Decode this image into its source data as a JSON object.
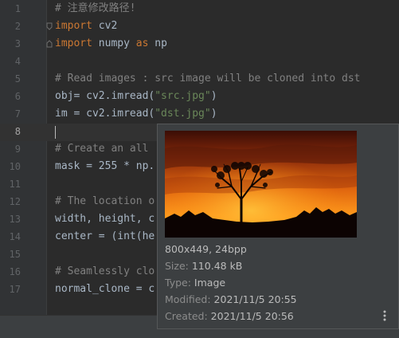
{
  "editor": {
    "active_line": "8",
    "lines": [
      {
        "n": "1",
        "code": [
          {
            "t": "# 注意修改路径!",
            "c": "cm"
          }
        ]
      },
      {
        "n": "2",
        "code": [
          {
            "t": "import",
            "c": "kw"
          },
          {
            "t": " cv2",
            "c": ""
          }
        ]
      },
      {
        "n": "3",
        "code": [
          {
            "t": "import",
            "c": "kw"
          },
          {
            "t": " numpy ",
            "c": ""
          },
          {
            "t": "as",
            "c": "kw"
          },
          {
            "t": " np",
            "c": ""
          }
        ]
      },
      {
        "n": "4",
        "code": []
      },
      {
        "n": "5",
        "code": [
          {
            "t": "# Read images : src image will be cloned into dst",
            "c": "cm"
          }
        ]
      },
      {
        "n": "6",
        "code": [
          {
            "t": "obj= cv2.imread(",
            "c": ""
          },
          {
            "t": "\"src.jpg\"",
            "c": "st"
          },
          {
            "t": ")",
            "c": ""
          }
        ]
      },
      {
        "n": "7",
        "code": [
          {
            "t": "im = cv2.imread(",
            "c": ""
          },
          {
            "t": "\"dst.jpg\"",
            "c": "st"
          },
          {
            "t": ")",
            "c": ""
          }
        ]
      },
      {
        "n": "8",
        "code": []
      },
      {
        "n": "9",
        "code": [
          {
            "t": "# Create an all",
            "c": "cm"
          }
        ]
      },
      {
        "n": "10",
        "code": [
          {
            "t": "mask = ",
            "c": ""
          },
          {
            "t": "255",
            "c": ""
          },
          {
            "t": " * np.",
            "c": ""
          }
        ]
      },
      {
        "n": "11",
        "code": []
      },
      {
        "n": "12",
        "code": [
          {
            "t": "# The location o",
            "c": "cm"
          }
        ]
      },
      {
        "n": "13",
        "code": [
          {
            "t": "width, height, c",
            "c": ""
          }
        ]
      },
      {
        "n": "14",
        "code": [
          {
            "t": "center = (int(he",
            "c": ""
          }
        ]
      },
      {
        "n": "15",
        "code": []
      },
      {
        "n": "16",
        "code": [
          {
            "t": "# Seamlessly clo",
            "c": "cm"
          }
        ]
      },
      {
        "n": "17",
        "code": [
          {
            "t": "normal_clone = c",
            "c": ""
          }
        ]
      }
    ]
  },
  "popup": {
    "dimensions": "800x449, 24bpp",
    "size_label": "Size:",
    "size_value": "110.48 kB",
    "type_label": "Type:",
    "type_value": "Image",
    "modified_label": "Modified:",
    "modified_value": "2021/11/5 20:55",
    "created_label": "Created:",
    "created_value": "2021/11/5 20:56"
  },
  "colors": {
    "keyword": "#cc7832",
    "comment": "#808080",
    "string": "#6a8759",
    "text": "#a9b7c6",
    "background": "#2b2b2b"
  },
  "icons": {
    "fold": "fold-marker-icon",
    "more": "vertical-ellipsis-icon"
  }
}
